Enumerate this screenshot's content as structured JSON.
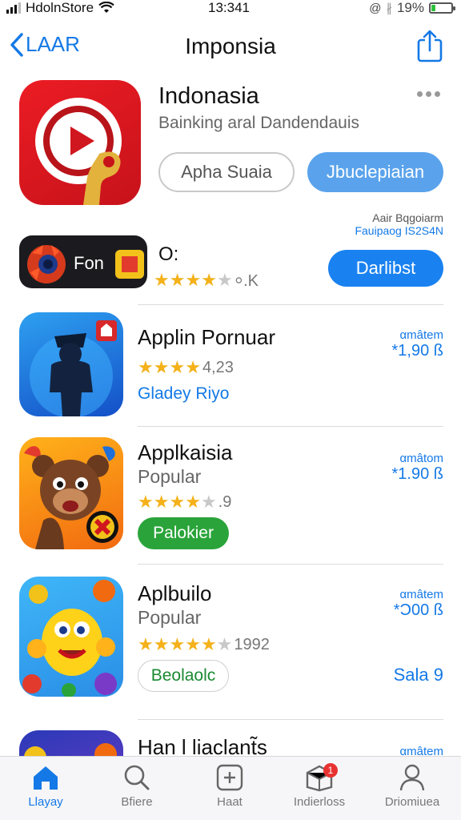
{
  "status_bar": {
    "carrier": "HdolnStore",
    "time": "13:341",
    "battery": "19%",
    "battery_level": 0.19,
    "colors": {
      "battery": "#2ec13c"
    }
  },
  "nav": {
    "back_label": "LAAR",
    "title": "Imponsia"
  },
  "featured": {
    "title": "Indonasia",
    "subtitle": "Bainking aral Dandendauis",
    "secondary_button": "Apha Suaia",
    "primary_button": "Jbuclepiaian",
    "meta_line1": "Aair Bqgoiarm",
    "meta_line2": "Fauipaog IS2S4N"
  },
  "row2": {
    "banner_text": "Fon",
    "name": "O:",
    "rating": 4,
    "rating_text": "⸰.K",
    "button": "Darlibst"
  },
  "apps": [
    {
      "name": "Applin Pornuar",
      "rating": 4,
      "rating_text": "4,23",
      "link": "Gladey Riyo",
      "price_line1": "αmâtem",
      "price_line2": "*1,90 ß"
    },
    {
      "name": "Applkaisia",
      "category": "Popular",
      "rating": 4,
      "rating_text": ".9",
      "button": "Palokier",
      "price_line1": "αmâtom",
      "price_line2": "*1.90 ß"
    },
    {
      "name": "Aplbuilo",
      "category": "Popular",
      "rating": 5,
      "rating_text": "1992",
      "button": "Beolaolc",
      "price_line1": "αmâtem",
      "price_line2": "*Ɔ00 ß",
      "side_text": "Sala 9"
    },
    {
      "name": "Han l liaclant̃s",
      "price_line1": "αmâtem"
    }
  ],
  "tabs": [
    {
      "label": "Llayay",
      "icon": "home-icon",
      "active": true
    },
    {
      "label": "Bfiere",
      "icon": "search-icon"
    },
    {
      "label": "Haat",
      "icon": "plus-box-icon"
    },
    {
      "label": "Indierloss",
      "icon": "box-icon",
      "badge": "1"
    },
    {
      "label": "Driomiuea",
      "icon": "person-icon"
    }
  ],
  "colors": {
    "accent": "#1479e6",
    "button_blue": "#1a82f0",
    "light_blue": "#5aa3ec",
    "green": "#2aa43a",
    "star": "#f4b11a"
  }
}
